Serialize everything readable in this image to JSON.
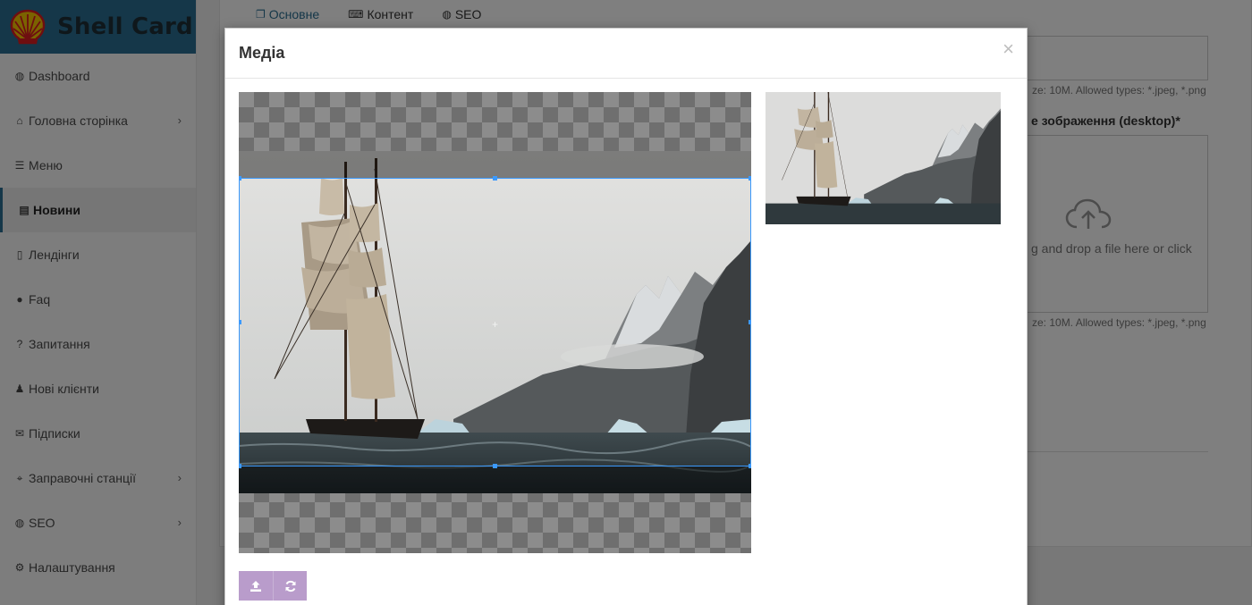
{
  "brand": {
    "name": "Shell Card",
    "logo_icon": "shell-logo-icon",
    "logo_color": "#f7c600",
    "logo_accent": "#dd1d21"
  },
  "sidebar": {
    "items": [
      {
        "label": "Dashboard",
        "icon": "globe-icon",
        "has_submenu": false,
        "active": false
      },
      {
        "label": "Головна сторінка",
        "icon": "home-icon",
        "has_submenu": true,
        "active": false
      },
      {
        "label": "Меню",
        "icon": "bars-icon",
        "has_submenu": false,
        "active": false
      },
      {
        "label": "Новини",
        "icon": "newspaper-icon",
        "has_submenu": false,
        "active": true
      },
      {
        "label": "Лендінги",
        "icon": "file-icon",
        "has_submenu": false,
        "active": false
      },
      {
        "label": "Faq",
        "icon": "question-circle-icon",
        "has_submenu": false,
        "active": false
      },
      {
        "label": "Запитання",
        "icon": "question-icon",
        "has_submenu": false,
        "active": false
      },
      {
        "label": "Нові клієнти",
        "icon": "users-icon",
        "has_submenu": false,
        "active": false
      },
      {
        "label": "Підписки",
        "icon": "envelope-icon",
        "has_submenu": false,
        "active": false
      },
      {
        "label": "Заправочні станції",
        "icon": "binoculars-icon",
        "has_submenu": true,
        "active": false
      },
      {
        "label": "SEO",
        "icon": "globe-icon",
        "has_submenu": true,
        "active": false
      },
      {
        "label": "Налаштування",
        "icon": "cogs-icon",
        "has_submenu": false,
        "active": false
      }
    ],
    "accent_color": "#2a6f92"
  },
  "page": {
    "tabs": [
      {
        "label": "Основне",
        "icon": "copy-icon",
        "active": true
      },
      {
        "label": "Контент",
        "icon": "keyboard-icon",
        "active": false
      },
      {
        "label": "SEO",
        "icon": "globe-icon",
        "active": false
      }
    ],
    "upload_hint_1": "ze: 10M. Allowed types: *.jpeg, *.png",
    "image_label": "е зображення (desktop)*",
    "dropzone_text": "g and drop a file here or click",
    "dropzone_icon": "cloud-upload-icon",
    "upload_hint_2": "ze: 10M. Allowed types: *.jpeg, *.png"
  },
  "modal": {
    "title": "Медіа",
    "close_icon": "close-icon",
    "close_glyph": "×",
    "toolbar": {
      "upload_icon": "upload-icon",
      "reset_icon": "refresh-icon",
      "button_color": "#b99ccb"
    },
    "crop_color": "#3b99fc",
    "image_subject": "tall-ship-image"
  }
}
